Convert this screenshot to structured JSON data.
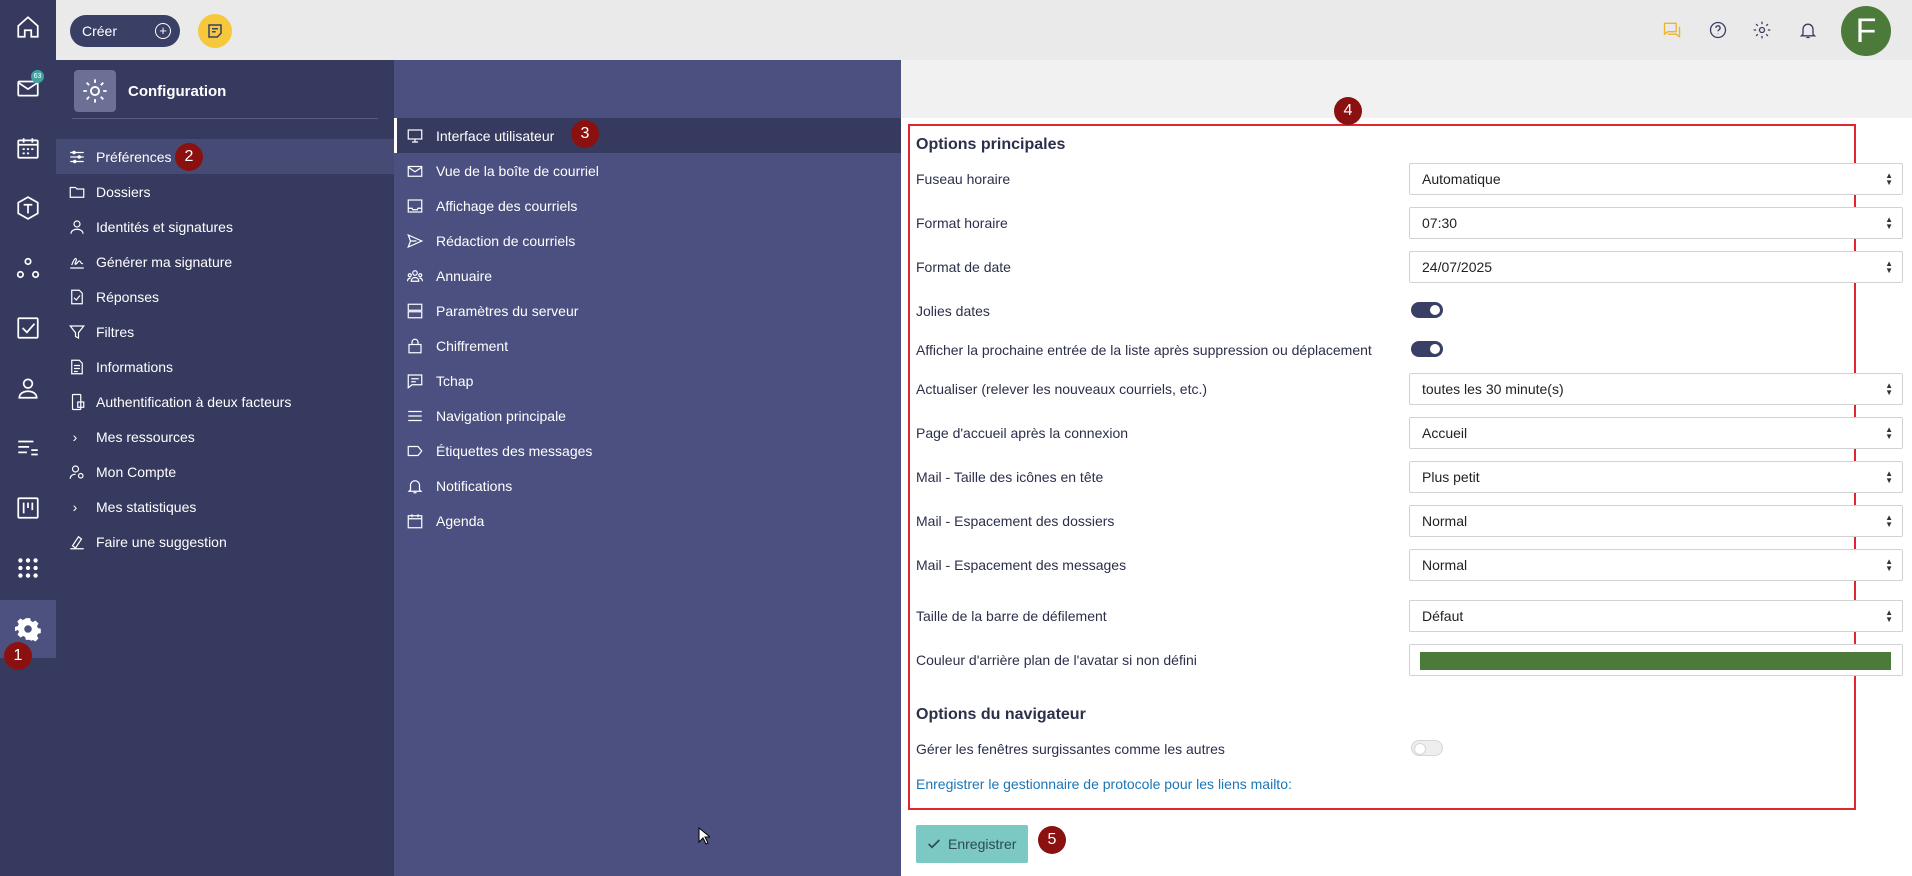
{
  "topbar": {
    "create_label": "Créer",
    "avatar_letter": "F"
  },
  "rail": {
    "mail_badge": "63",
    "items": [
      "home-icon",
      "mail-icon",
      "calendar-icon",
      "tchap-icon",
      "nodes-icon",
      "tasks-icon",
      "contacts-icon",
      "list-icon",
      "board-icon",
      "apps-grid-icon",
      "settings-icon"
    ]
  },
  "settings_sidebar": {
    "title": "Configuration",
    "items": [
      {
        "label": "Préférences",
        "icon": "sliders-icon"
      },
      {
        "label": "Dossiers",
        "icon": "folder-icon"
      },
      {
        "label": "Identités et signatures",
        "icon": "person-icon"
      },
      {
        "label": "Générer ma signature",
        "icon": "signature-icon"
      },
      {
        "label": "Réponses",
        "icon": "document-check-icon"
      },
      {
        "label": "Filtres",
        "icon": "filter-icon"
      },
      {
        "label": "Informations",
        "icon": "info-document-icon"
      },
      {
        "label": "Authentification à deux facteurs",
        "icon": "phone-lock-icon"
      },
      {
        "label": "Mes ressources",
        "icon": "chevron-right-icon"
      },
      {
        "label": "Mon Compte",
        "icon": "account-gear-icon"
      },
      {
        "label": "Mes statistiques",
        "icon": "chevron-right-icon"
      },
      {
        "label": "Faire une suggestion",
        "icon": "suggestion-icon"
      }
    ]
  },
  "sections": [
    {
      "label": "Interface utilisateur",
      "icon": "monitor-icon"
    },
    {
      "label": "Vue de la boîte de courriel",
      "icon": "envelope-icon"
    },
    {
      "label": "Affichage des courriels",
      "icon": "inbox-icon"
    },
    {
      "label": "Rédaction de courriels",
      "icon": "send-icon"
    },
    {
      "label": "Annuaire",
      "icon": "group-icon"
    },
    {
      "label": "Paramètres du serveur",
      "icon": "server-icon"
    },
    {
      "label": "Chiffrement",
      "icon": "lock-icon"
    },
    {
      "label": "Tchap",
      "icon": "chat-icon"
    },
    {
      "label": "Navigation principale",
      "icon": "menu-icon"
    },
    {
      "label": "Étiquettes des messages",
      "icon": "tag-icon"
    },
    {
      "label": "Notifications",
      "icon": "bell-icon"
    },
    {
      "label": "Agenda",
      "icon": "calendar-icon"
    }
  ],
  "main": {
    "section_title": "Options principales",
    "rows": [
      {
        "label": "Fuseau horaire",
        "type": "select",
        "value": "Automatique"
      },
      {
        "label": "Format horaire",
        "type": "select",
        "value": "07:30"
      },
      {
        "label": "Format de date",
        "type": "select",
        "value": "24/07/2025"
      },
      {
        "label": "Jolies dates",
        "type": "toggle",
        "on": true
      },
      {
        "label": "Afficher la prochaine entrée de la liste après suppression ou déplacement",
        "type": "toggle",
        "on": true
      },
      {
        "label": "Actualiser (relever les nouveaux courriels, etc.)",
        "type": "select",
        "value": "toutes les 30 minute(s)"
      },
      {
        "label": "Page d'accueil après la connexion",
        "type": "select",
        "value": "Accueil"
      },
      {
        "label": "Mail - Taille des icônes en tête",
        "type": "select",
        "value": "Plus petit"
      },
      {
        "label": "Mail - Espacement des dossiers",
        "type": "select",
        "value": "Normal"
      },
      {
        "label": "Mail - Espacement des messages",
        "type": "select",
        "value": "Normal"
      },
      {
        "label": "Taille de la barre de défilement",
        "type": "select",
        "value": "Défaut"
      },
      {
        "label": "Couleur d'arrière plan de l'avatar si non défini",
        "type": "color",
        "value": "#4b7a3a"
      }
    ],
    "browser_title": "Options du navigateur",
    "browser_rows": [
      {
        "label": "Gérer les fenêtres surgissantes comme les autres",
        "type": "toggle",
        "on": false
      }
    ],
    "mailto_link": "Enregistrer le gestionnaire de protocole pour les liens mailto:",
    "save_label": "Enregistrer"
  },
  "markers": [
    "1",
    "2",
    "3",
    "4",
    "5"
  ],
  "colors": {
    "rail": "#363a5e",
    "section_list": "#4b5080",
    "marker": "#8b1111",
    "highlight": "#e0262f",
    "save": "#7cc8c3",
    "notes": "#f6c83b"
  }
}
